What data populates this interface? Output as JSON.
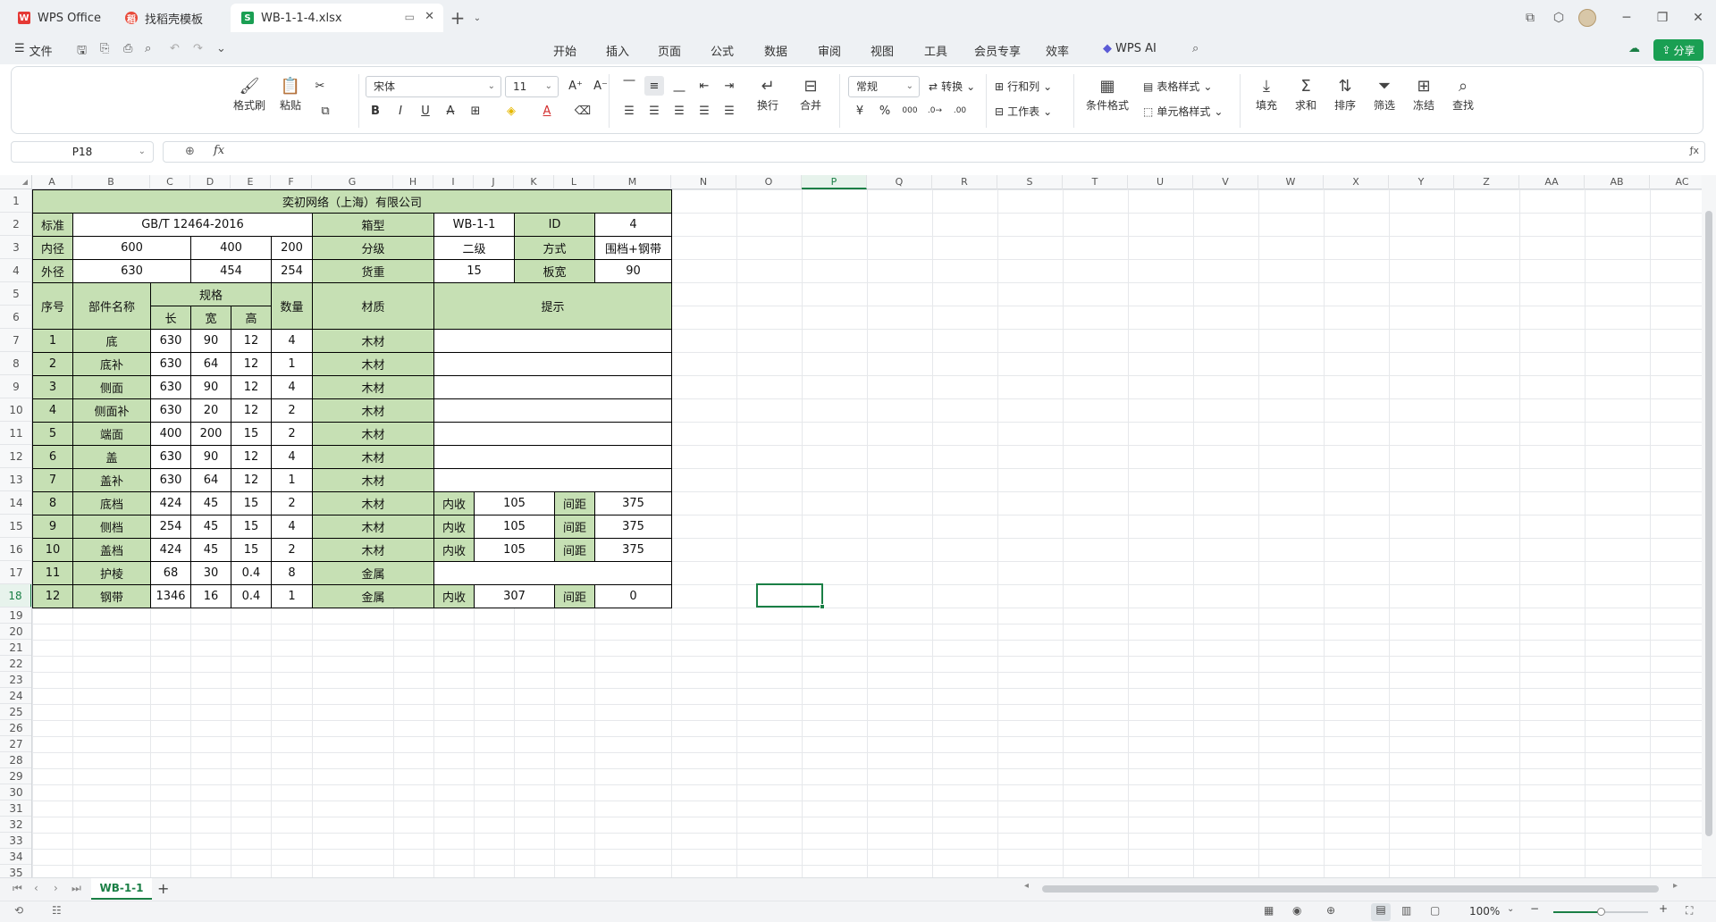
{
  "tabs": [
    {
      "label": "WPS Office",
      "icon": "wps-logo-icon",
      "active": false
    },
    {
      "label": "找稻壳模板",
      "icon": "daoke-icon",
      "active": false
    },
    {
      "label": "WB-1-1-4.xlsx",
      "icon": "spreadsheet-icon",
      "active": true
    }
  ],
  "menu": {
    "file": "文件",
    "items": [
      "开始",
      "插入",
      "页面",
      "公式",
      "数据",
      "审阅",
      "视图",
      "工具",
      "会员专享",
      "效率"
    ],
    "active": "开始",
    "wps_ai": "WPS AI",
    "share": "分享"
  },
  "ribbon": {
    "format_painter": "格式刷",
    "paste": "粘贴",
    "font": "宋体",
    "font_size": "11",
    "wrap": "换行",
    "merge": "合并",
    "number_format": "常规",
    "convert": "转换",
    "row_col": "行和列",
    "worksheet": "工作表",
    "cond_format": "条件格式",
    "table_style": "表格样式",
    "cell_style": "单元格样式",
    "fill": "填充",
    "sum": "求和",
    "sort": "排序",
    "filter": "筛选",
    "freeze": "冻结",
    "find": "查找"
  },
  "formula_bar": {
    "name_box": "P18",
    "fx": "fx",
    "value": ""
  },
  "columns": [
    "A",
    "B",
    "C",
    "D",
    "E",
    "F",
    "G",
    "H",
    "I",
    "J",
    "K",
    "L",
    "M",
    "N",
    "O",
    "P",
    "Q",
    "R",
    "S",
    "T",
    "U",
    "V",
    "W",
    "X",
    "Y",
    "Z",
    "AA",
    "AB",
    "AC",
    "A"
  ],
  "active_column": "P",
  "rows": [
    "1",
    "2",
    "3",
    "4",
    "5",
    "6",
    "7",
    "8",
    "9",
    "10",
    "11",
    "12",
    "13",
    "14",
    "15",
    "16",
    "17",
    "18",
    "19",
    "20",
    "21",
    "22",
    "23",
    "24",
    "25",
    "26",
    "27",
    "28",
    "29",
    "30",
    "31",
    "32",
    "33",
    "34",
    "35"
  ],
  "active_row": "18",
  "table": {
    "company": "奕初网络（上海）有限公司",
    "r2": {
      "std_label": "标准",
      "std": "GB/T 12464-2016",
      "type_label": "箱型",
      "type": "WB-1-1",
      "id_label": "ID",
      "id": "4"
    },
    "r3": {
      "inner_label": "内径",
      "c": "600",
      "d": "400",
      "e": "200",
      "grade_label": "分级",
      "grade": "二级",
      "mode_label": "方式",
      "mode": "围档+钢带"
    },
    "r4": {
      "outer_label": "外径",
      "c": "630",
      "d": "454",
      "e": "254",
      "load_label": "货重",
      "load": "15",
      "thick_label": "板宽",
      "thick": "90"
    },
    "header": {
      "no": "序号",
      "part": "部件名称",
      "spec": "规格",
      "len": "长",
      "wid": "宽",
      "hgt": "高",
      "qty": "数量",
      "mat": "材质",
      "hint": "提示"
    },
    "parts": [
      {
        "no": "1",
        "name": "底",
        "l": "630",
        "w": "90",
        "h": "12",
        "q": "4",
        "m": "木材",
        "extra": null
      },
      {
        "no": "2",
        "name": "底补",
        "l": "630",
        "w": "64",
        "h": "12",
        "q": "1",
        "m": "木材",
        "extra": null
      },
      {
        "no": "3",
        "name": "侧面",
        "l": "630",
        "w": "90",
        "h": "12",
        "q": "4",
        "m": "木材",
        "extra": null
      },
      {
        "no": "4",
        "name": "侧面补",
        "l": "630",
        "w": "20",
        "h": "12",
        "q": "2",
        "m": "木材",
        "extra": null
      },
      {
        "no": "5",
        "name": "端面",
        "l": "400",
        "w": "200",
        "h": "15",
        "q": "2",
        "m": "木材",
        "extra": null
      },
      {
        "no": "6",
        "name": "盖",
        "l": "630",
        "w": "90",
        "h": "12",
        "q": "4",
        "m": "木材",
        "extra": null
      },
      {
        "no": "7",
        "name": "盖补",
        "l": "630",
        "w": "64",
        "h": "12",
        "q": "1",
        "m": "木材",
        "extra": null
      },
      {
        "no": "8",
        "name": "底档",
        "l": "424",
        "w": "45",
        "h": "15",
        "q": "2",
        "m": "木材",
        "extra": {
          "a": "内收",
          "b": "105",
          "c": "间距",
          "d": "375"
        }
      },
      {
        "no": "9",
        "name": "侧档",
        "l": "254",
        "w": "45",
        "h": "15",
        "q": "4",
        "m": "木材",
        "extra": {
          "a": "内收",
          "b": "105",
          "c": "间距",
          "d": "375"
        }
      },
      {
        "no": "10",
        "name": "盖档",
        "l": "424",
        "w": "45",
        "h": "15",
        "q": "2",
        "m": "木材",
        "extra": {
          "a": "内收",
          "b": "105",
          "c": "间距",
          "d": "375"
        }
      },
      {
        "no": "11",
        "name": "护棱",
        "l": "68",
        "w": "30",
        "h": "0.4",
        "q": "8",
        "m": "金属",
        "extra": null
      },
      {
        "no": "12",
        "name": "钢带",
        "l": "1346",
        "w": "16",
        "h": "0.4",
        "q": "1",
        "m": "金属",
        "extra": {
          "a": "内收",
          "b": "307",
          "c": "间距",
          "d": "0"
        }
      }
    ]
  },
  "sheet_tabs": [
    {
      "label": "WB-1-1",
      "active": true
    }
  ],
  "status": {
    "zoom": "100%"
  },
  "colors": {
    "accent": "#1a7f45",
    "header_fill": "#c6e0b4"
  }
}
